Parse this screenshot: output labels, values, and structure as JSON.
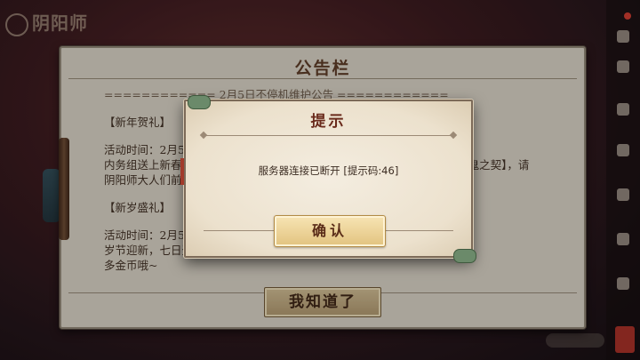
{
  "background": {
    "logo_text": "阴阳师"
  },
  "board": {
    "title": "公告栏",
    "lines": [
      "============ 2月5日不停机维护公告 ============",
      "【新年贺礼】",
      "活动时间：2月5日维护后-2月28日",
      "内务组送上新春大礼，登录即可获得新春限定礼包，内含【式神】*30张【鬼之契】，请",
      "阴阳师大人们前往邮件中查收~",
      "【新岁盛礼】",
      "活动时间：2月5日维护后-2月28日",
      "岁节迎新，七日登录即可获得丰厚奖励，累计7日，还能领取更",
      "多金币哦~"
    ],
    "button_label": "我知道了"
  },
  "dialog": {
    "title": "提示",
    "message": "服务器连接已断开 [提示码:46]",
    "confirm_label": "确认"
  },
  "colors": {
    "board_bg": "#cfc9bc",
    "dialog_bg": "#f4ede0",
    "title_red": "#6a2a1c",
    "gold_button": "#e2c37f"
  }
}
